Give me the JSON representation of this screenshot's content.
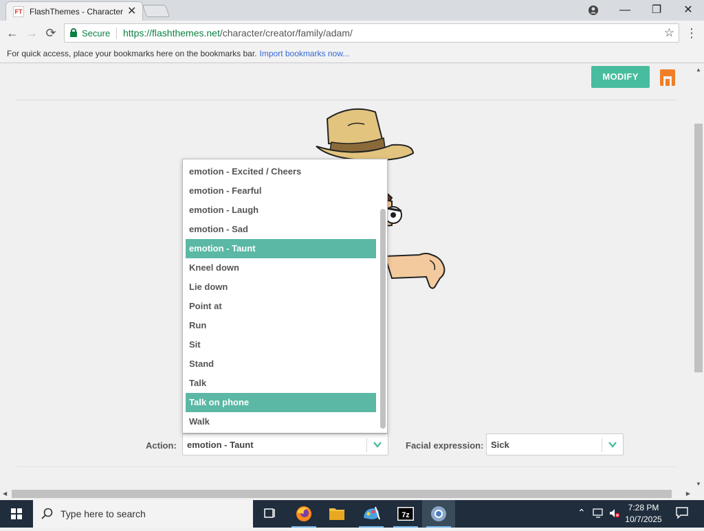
{
  "browser": {
    "tab_title": "FlashThemes - Character",
    "tab_favicon_text": "FT",
    "secure_label": "Secure",
    "url_scheme_host": "https://flashthemes.net",
    "url_path": "/character/creator/family/adam/",
    "bookmarks_hint": "For quick access, place your bookmarks here on the bookmarks bar.",
    "bookmarks_import": "Import bookmarks now..."
  },
  "page": {
    "modify_label": "MODIFY",
    "action_label": "Action:",
    "action_value": "emotion - Taunt",
    "facial_label": "Facial expression:",
    "facial_value": "Sick",
    "dropdown_options": [
      {
        "label": "emotion - Excited / Cheers",
        "selected": false
      },
      {
        "label": "emotion - Fearful",
        "selected": false
      },
      {
        "label": "emotion - Laugh",
        "selected": false
      },
      {
        "label": "emotion - Sad",
        "selected": false
      },
      {
        "label": "emotion - Taunt",
        "selected": true
      },
      {
        "label": "Kneel down",
        "selected": false
      },
      {
        "label": "Lie down",
        "selected": false
      },
      {
        "label": "Point at",
        "selected": false
      },
      {
        "label": "Run",
        "selected": false
      },
      {
        "label": "Sit",
        "selected": false
      },
      {
        "label": "Stand",
        "selected": false
      },
      {
        "label": "Talk",
        "selected": false
      },
      {
        "label": "Talk on phone",
        "selected": true
      },
      {
        "label": "Walk",
        "selected": false
      }
    ],
    "accent_color": "#48bc9e"
  },
  "taskbar": {
    "search_placeholder": "Type here to search",
    "time": "7:28 PM",
    "date": "10/7/2025",
    "apps": [
      "task-view-icon",
      "firefox-icon",
      "file-explorer-icon",
      "paint-icon",
      "7zip-icon",
      "chrome-icon"
    ]
  }
}
